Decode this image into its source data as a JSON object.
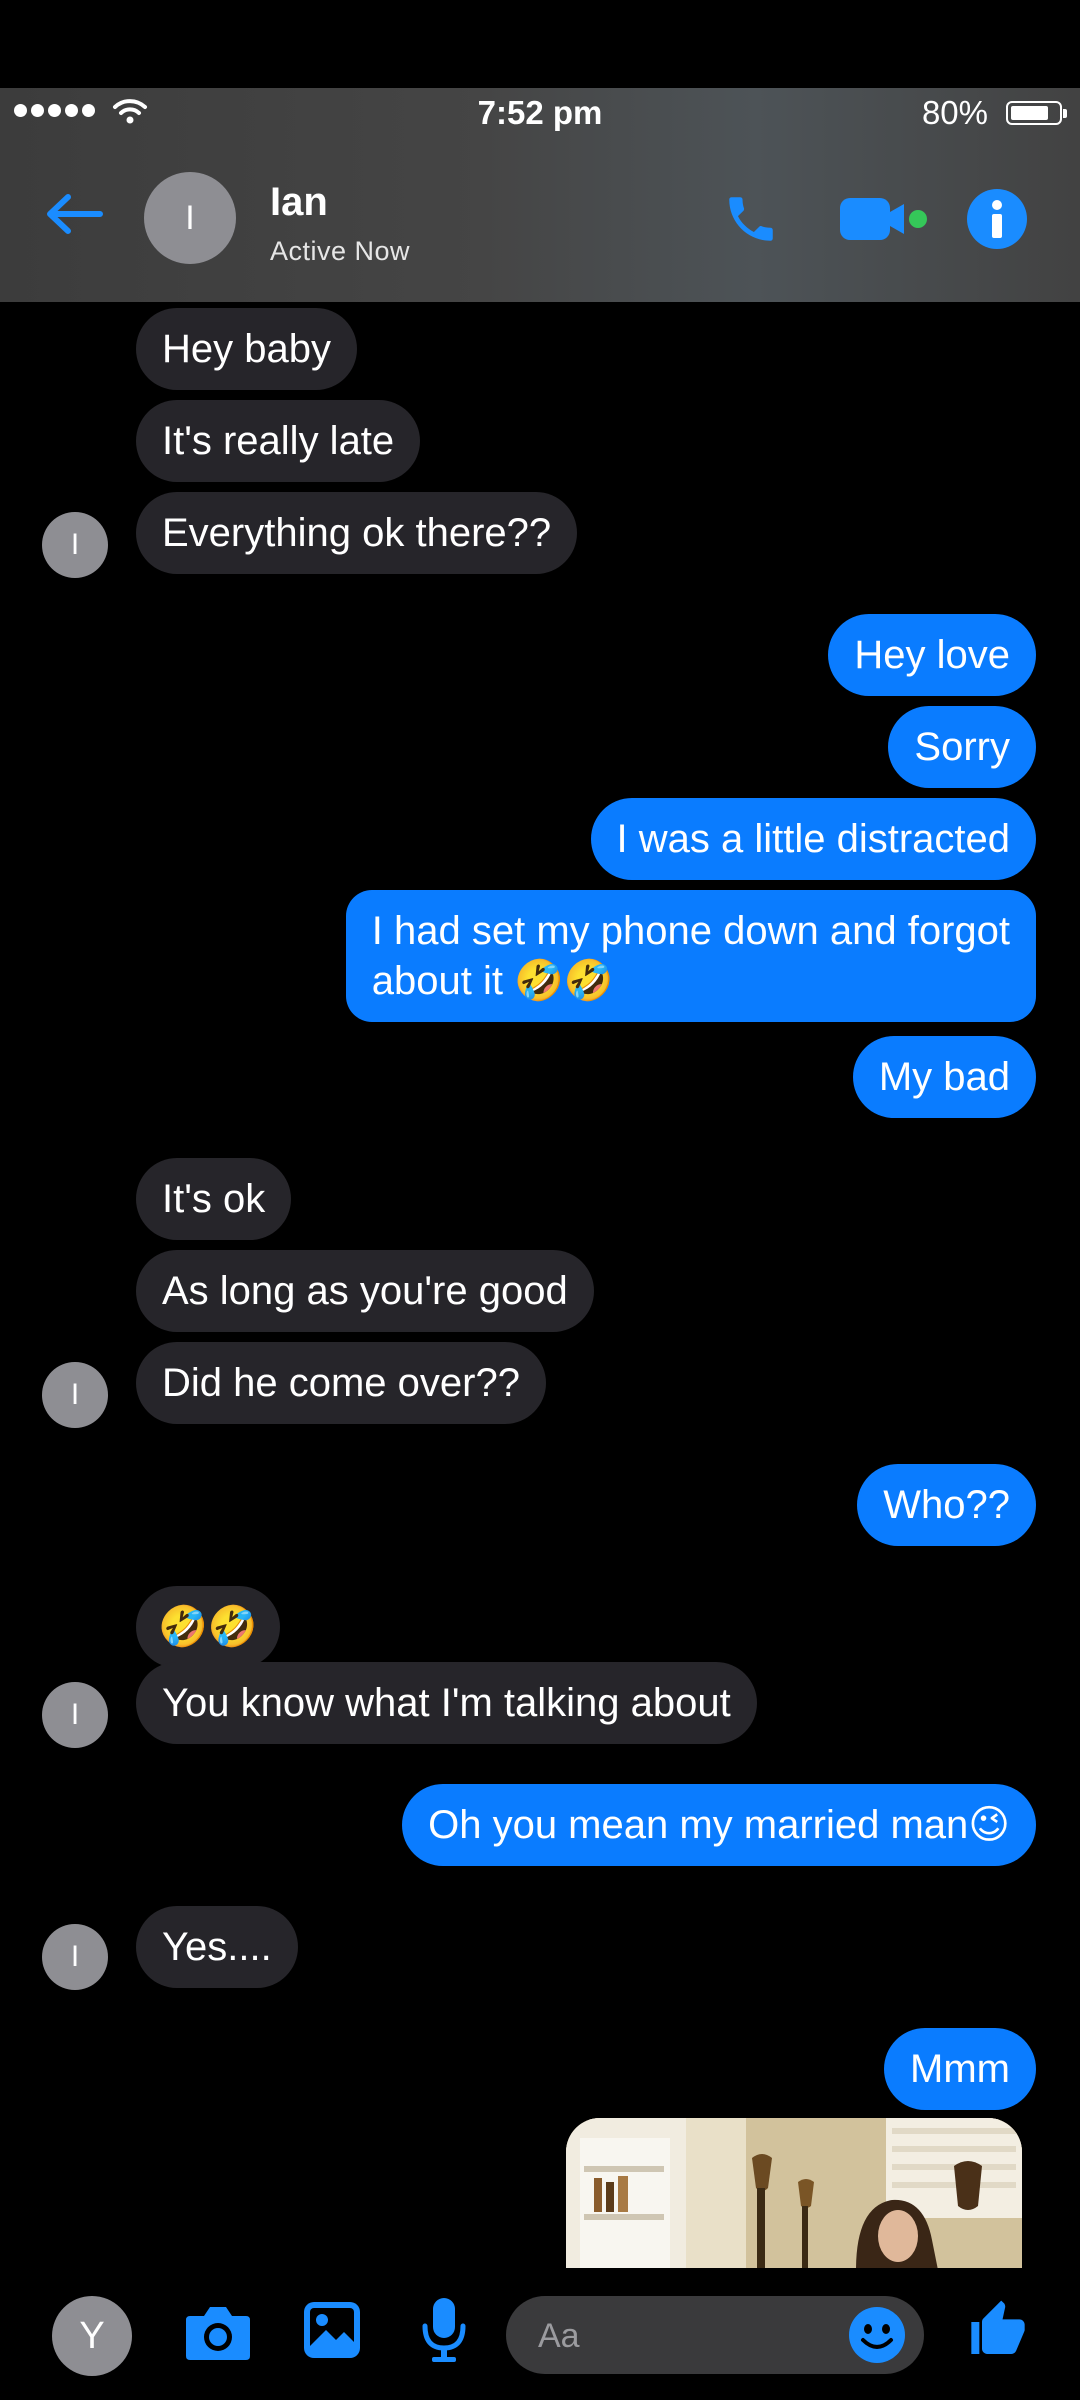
{
  "status_bar": {
    "time": "7:52 pm",
    "battery_percent": "80%",
    "battery_level": 0.8
  },
  "header": {
    "avatar_initial": "I",
    "contact_name": "Ian",
    "contact_status": "Active Now"
  },
  "messages": [
    {
      "from": "them",
      "text": "Hey baby"
    },
    {
      "from": "them",
      "text": "It's really late"
    },
    {
      "from": "them",
      "text": "Everything ok there??",
      "avatar": "I"
    },
    {
      "from": "me",
      "text": "Hey love"
    },
    {
      "from": "me",
      "text": "Sorry"
    },
    {
      "from": "me",
      "text": "I was a little distracted"
    },
    {
      "from": "me",
      "line1": "I had set my phone down and forgot",
      "line2": "about it 🤣🤣"
    },
    {
      "from": "me",
      "text": "My bad"
    },
    {
      "from": "them",
      "text": "It's ok"
    },
    {
      "from": "them",
      "text": "As long as you're good"
    },
    {
      "from": "them",
      "text": "Did he come over??",
      "avatar": "I"
    },
    {
      "from": "me",
      "text": "Who??"
    },
    {
      "from": "them",
      "text": "🤣🤣"
    },
    {
      "from": "them",
      "text": "You know what I'm talking about",
      "avatar": "I"
    },
    {
      "from": "me",
      "text": "Oh you mean my married man😉"
    },
    {
      "from": "them",
      "text": "Yes....",
      "avatar": "I"
    },
    {
      "from": "me",
      "text": "Mmm"
    }
  ],
  "composer": {
    "me_initial": "Y",
    "placeholder": "Aa"
  },
  "colors": {
    "sent_bubble": "#0a7cff",
    "received_bubble": "#26252a",
    "accent": "#1a8cff",
    "video_dot": "#35c759"
  },
  "icons": [
    "wifi-icon",
    "battery-icon",
    "back-arrow-icon",
    "phone-icon",
    "video-icon",
    "info-icon",
    "camera-icon",
    "gallery-icon",
    "microphone-icon",
    "emoji-icon",
    "like-icon"
  ]
}
